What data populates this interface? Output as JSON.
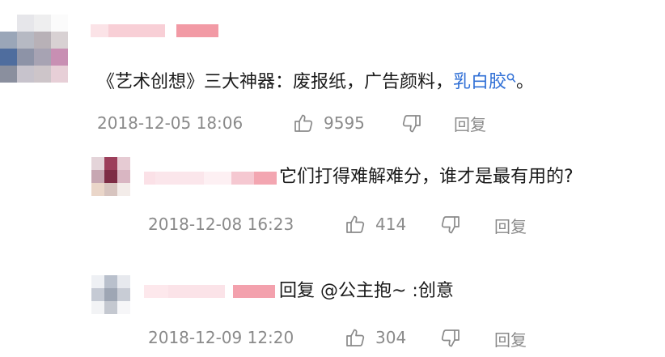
{
  "comment": {
    "text_main": "《艺术创想》三大神器：废报纸，广告颜料，",
    "link_text": "乳白胶",
    "text_end": "。",
    "timestamp": "2018-12-05 18:06",
    "likes": "9595",
    "reply_label": "回复"
  },
  "replies": [
    {
      "text": "它们打得难解难分，谁才是最有用的?",
      "timestamp": "2018-12-08 16:23",
      "likes": "414",
      "reply_label": "回复"
    },
    {
      "text": "回复 @公主抱~ :创意",
      "timestamp": "2018-12-09 12:20",
      "likes": "304",
      "reply_label": "回复"
    }
  ],
  "colors": {
    "link": "#2f6fd6",
    "meta": "#8a8a8a"
  }
}
